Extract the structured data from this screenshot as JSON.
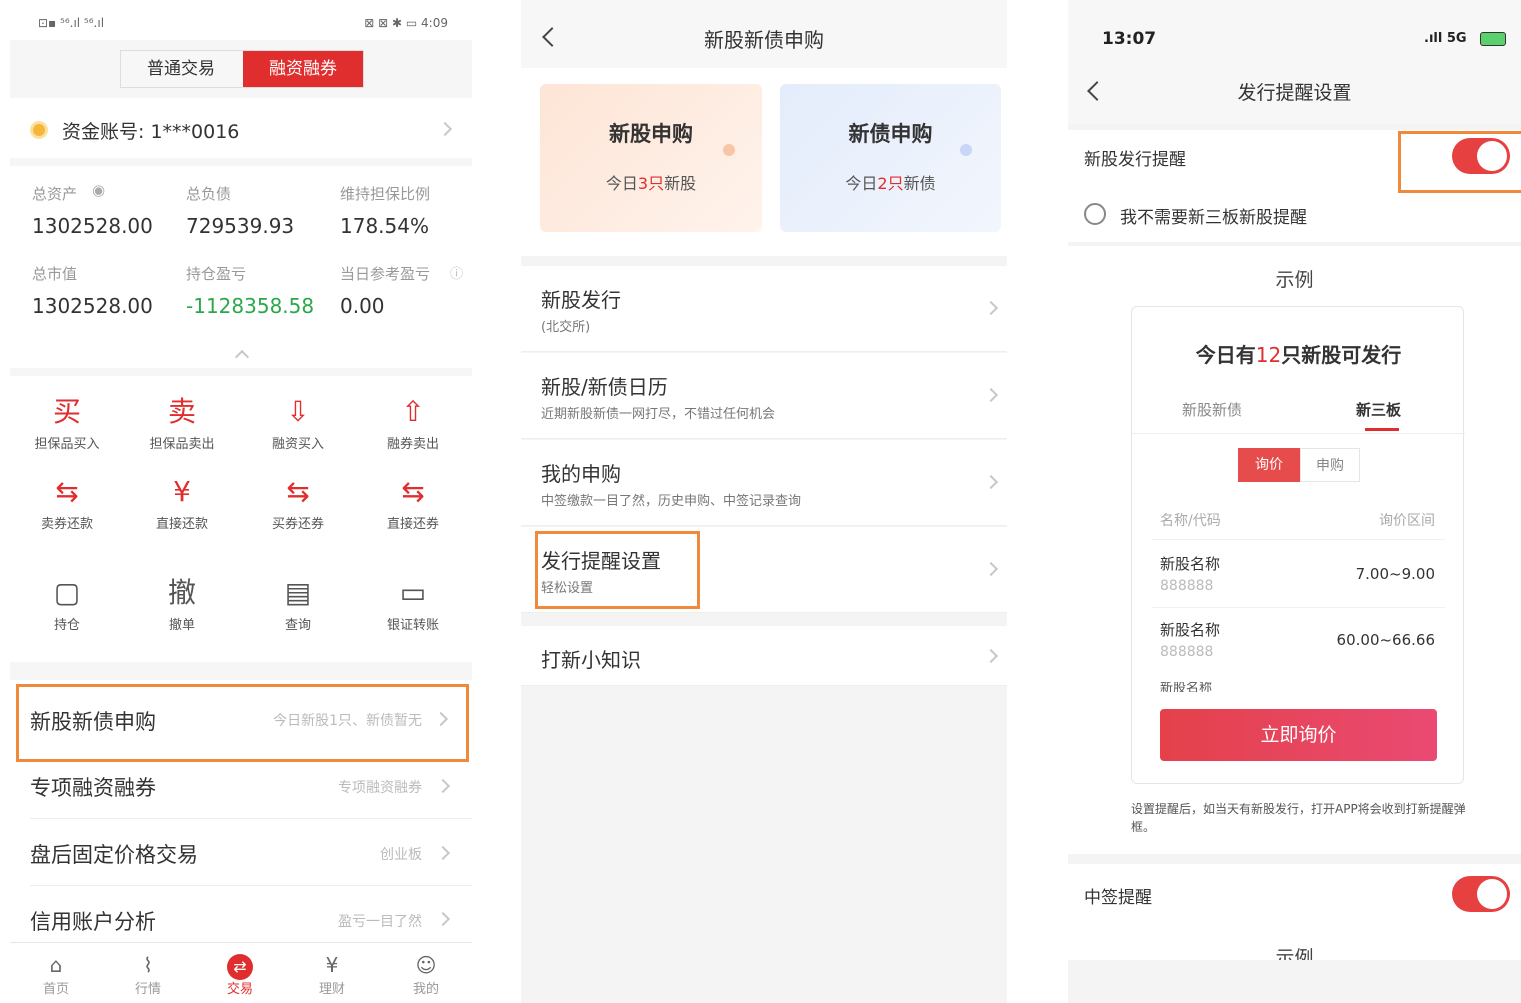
{
  "phone1": {
    "status_left": "⊡▪ ⁵⁶.ıl ⁵⁶.ıl",
    "status_right": "⊠ ⊠ ✱ ▭ 4:09",
    "tabs": [
      "普通交易",
      "融资融券"
    ],
    "account_label": "资金账号: 1***0016",
    "stats": [
      {
        "label": "总资产",
        "value": "1302528.00"
      },
      {
        "label": "总负债",
        "value": "729539.93"
      },
      {
        "label": "维持担保比例",
        "value": "178.54%"
      },
      {
        "label": "总市值",
        "value": "1302528.00"
      },
      {
        "label": "持仓盈亏",
        "value": "-1128358.58"
      },
      {
        "label": "当日参考盈亏",
        "value": "0.00"
      }
    ],
    "quick_actions": [
      {
        "glyph": "买",
        "label": "担保品买入"
      },
      {
        "glyph": "卖",
        "label": "担保品卖出"
      },
      {
        "glyph": "⇩",
        "label": "融资买入"
      },
      {
        "glyph": "⇧",
        "label": "融券卖出"
      },
      {
        "glyph": "⇆",
        "label": "卖券还款"
      },
      {
        "glyph": "¥",
        "label": "直接还款"
      },
      {
        "glyph": "⇆",
        "label": "买券还券"
      },
      {
        "glyph": "⇆",
        "label": "直接还券"
      },
      {
        "glyph": "▢",
        "label": "持仓"
      },
      {
        "glyph": "撤",
        "label": "撤单"
      },
      {
        "glyph": "▤",
        "label": "查询"
      },
      {
        "glyph": "▭",
        "label": "银证转账"
      }
    ],
    "rows": [
      {
        "title": "新股新债申购",
        "sub": "今日新股1只、新债暂无"
      },
      {
        "title": "专项融资融券",
        "sub": "专项融资融券"
      },
      {
        "title": "盘后固定价格交易",
        "sub": "创业板"
      },
      {
        "title": "信用账户分析",
        "sub": "盈亏一目了然"
      }
    ],
    "nav": [
      {
        "icon": "⌂",
        "label": "首页"
      },
      {
        "icon": "⌇",
        "label": "行情"
      },
      {
        "icon": "⇄",
        "label": "交易"
      },
      {
        "icon": "¥",
        "label": "理财"
      },
      {
        "icon": "☺",
        "label": "我的"
      }
    ]
  },
  "phone2": {
    "title": "新股新债申购",
    "cards": [
      {
        "title": "新股申购",
        "pre": "今日",
        "num": "3只",
        "post": "新股"
      },
      {
        "title": "新债申购",
        "pre": "今日",
        "num": "2只",
        "post": "新债"
      }
    ],
    "menu": [
      {
        "title": "新股发行",
        "sub": "(北交所)"
      },
      {
        "title": "新股/新债日历",
        "sub": "近期新股新债一网打尽，不错过任何机会"
      },
      {
        "title": "我的申购",
        "sub": "中签缴款一目了然，历史申购、中签记录查询"
      },
      {
        "title": "发行提醒设置",
        "sub": "轻松设置"
      }
    ],
    "tips": "打新小知识"
  },
  "phone3": {
    "time": "13:07",
    "signal": ".ıll 5G",
    "title": "发行提醒设置",
    "ipo_reminder": "新股发行提醒",
    "no_neeq": "我不需要新三板新股提醒",
    "example": "示例",
    "card_title_pre": "今日有",
    "card_title_num": "12",
    "card_title_post": "只新股可发行",
    "card_tabs": [
      "新股新债",
      "新三板"
    ],
    "seg": [
      "询价",
      "申购"
    ],
    "col_name": "名称/代码",
    "col_range": "询价区间",
    "items": [
      {
        "name": "新股名称",
        "code": "888888",
        "range": "7.00~9.00"
      },
      {
        "name": "新股名称",
        "code": "888888",
        "range": "60.00~66.66"
      }
    ],
    "cut_item": "新股名称",
    "button": "立即询价",
    "note": "设置提醒后，如当天有新股发行，打开APP将会收到打新提醒弹框。",
    "winning": "中签提醒",
    "example2": "示例"
  },
  "colors": {
    "accent": "#e02e2e",
    "highlight": "#ef8a3c",
    "positive": "#2ba84a"
  }
}
